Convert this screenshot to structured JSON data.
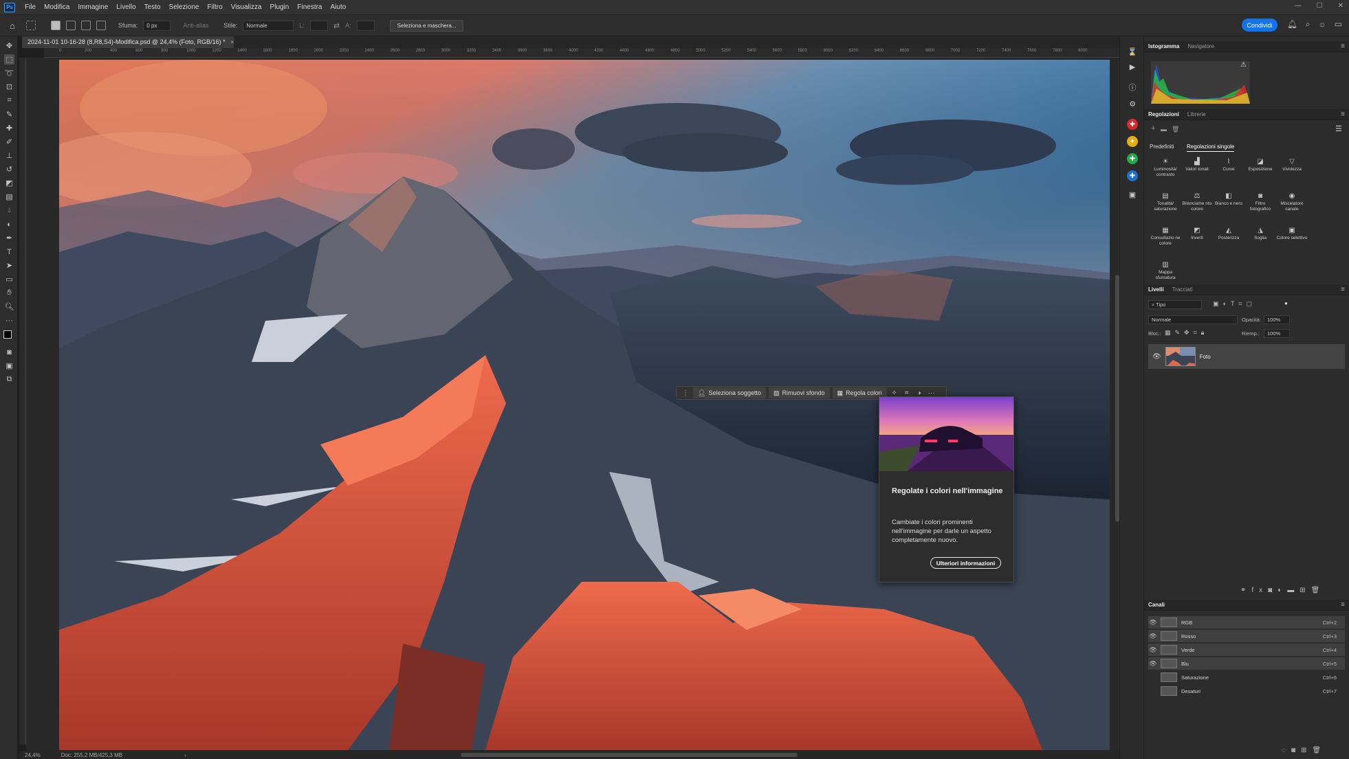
{
  "app": {
    "logo": "Ps"
  },
  "menu": [
    "File",
    "Modifica",
    "Immagine",
    "Livello",
    "Testo",
    "Selezione",
    "Filtro",
    "Visualizza",
    "Plugin",
    "Finestra",
    "Aiuto"
  ],
  "window_controls": {
    "minimize": "—",
    "maximize": "☐",
    "close": "✕"
  },
  "options": {
    "sfuma_label": "Sfuma:",
    "sfuma_value": "0 px",
    "antialias_label": "Anti-alias",
    "stile_label": "Stile:",
    "stile_value": "Normale",
    "l_label": "L:",
    "a_label": "A:",
    "mask_button": "Seleziona e maschera...",
    "share_button": "Condividi"
  },
  "document": {
    "tab_title": "2024-11-01 10-16-28 (8,R8,S4)-Modifica.psd @ 24,4% (Foto, RGB/16) *",
    "close": "×"
  },
  "ruler_labels": [
    "0",
    "200",
    "400",
    "600",
    "800",
    "1000",
    "1200",
    "1400",
    "1600",
    "1800",
    "2000",
    "2200",
    "2400",
    "2600",
    "2800",
    "3000",
    "3200",
    "3400",
    "3600",
    "3800",
    "4000",
    "4200",
    "4400",
    "4600",
    "4800",
    "5000",
    "5200",
    "5400",
    "5600",
    "5800",
    "6000",
    "6200",
    "6400",
    "6600",
    "6800",
    "7000",
    "7200",
    "7400",
    "7600",
    "7800",
    "8000"
  ],
  "status": {
    "zoom": "24,4%",
    "doc": "Doc: 255,2 MB/425,3 MB",
    "arrow": "›"
  },
  "context_bar": {
    "select_subject": "Seleziona soggetto",
    "remove_bg": "Rimuovi sfondo",
    "adjust_colors": "Regola colori",
    "more": "···"
  },
  "tip": {
    "title": "Regolate i colori nell'immagine",
    "body": "Cambiate i colori prominenti nell'immagine per darle un aspetto completamente nuovo.",
    "button": "Ulteriori informazioni"
  },
  "panels": {
    "tabs_top": [
      "Istogramma",
      "Navigatore"
    ],
    "tabs_adj": [
      "Regolazioni",
      "Librerie"
    ],
    "adj_subtabs": [
      "Predefiniti",
      "Regolazioni singole"
    ],
    "adjustments": [
      "Luminosità/ contrasto",
      "Valori tonali",
      "Curve",
      "Esposizione",
      "Vividezza",
      "Tonalità/ saturazione",
      "Bilanciame nto colore",
      "Bianco e nero",
      "Filtro fotografico",
      "Miscelatore canale",
      "Consultazio ne colore",
      "Inverti",
      "Posterizza",
      "Soglia",
      "Colore selettivo",
      "Mappa sfumatura"
    ],
    "tabs_layers": [
      "Livelli",
      "Tracciati"
    ],
    "layer_filter": "Tipo",
    "blend_mode": "Normale",
    "opacity_label": "Opacità:",
    "opacity_value": "100%",
    "lock_label": "Bloc.:",
    "fill_label": "Riemp.:",
    "fill_value": "100%",
    "layer_name": "Foto",
    "channels_title": "Canali",
    "channels": [
      {
        "name": "RGB",
        "shortcut": "Ctrl+2",
        "visible": true
      },
      {
        "name": "Rosso",
        "shortcut": "Ctrl+3",
        "visible": true
      },
      {
        "name": "Verde",
        "shortcut": "Ctrl+4",
        "visible": true
      },
      {
        "name": "Blu",
        "shortcut": "Ctrl+5",
        "visible": true
      },
      {
        "name": "Saturazione",
        "shortcut": "Ctrl+6",
        "visible": false
      },
      {
        "name": "Desaturi",
        "shortcut": "Ctrl+7",
        "visible": false
      }
    ]
  },
  "colors": {
    "accent": "#1473e6",
    "bg": "#1e1e1e",
    "panel": "#2c2c2c"
  }
}
